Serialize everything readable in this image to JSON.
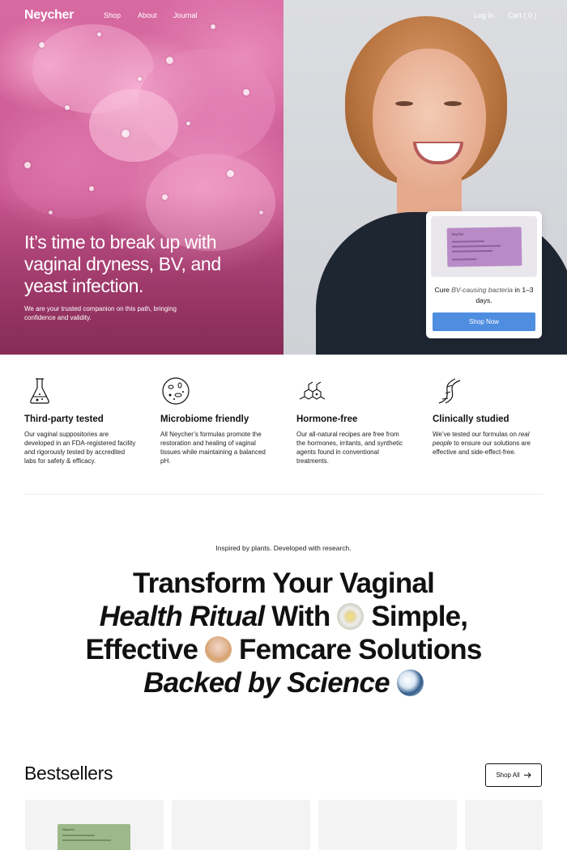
{
  "nav": {
    "logo": "Neycher",
    "links": [
      "Shop",
      "About",
      "Journal"
    ],
    "login": "Log In",
    "cart": "Cart ( 0 )"
  },
  "hero": {
    "headline": "It’s time to break up with vaginal dryness, BV, and yeast infection.",
    "subtext": "We are your trusted companion on this path, bringing confidence and validity.",
    "promo": {
      "pack_brand": "Neycher",
      "text_before": "Cure ",
      "text_em": "BV-causing bacteria",
      "text_after": " in 1–3 days.",
      "button": "Shop Now"
    }
  },
  "features": [
    {
      "icon": "flask-icon",
      "title": "Third-party tested",
      "body": "Our vaginal suppositories are developed in an FDA-registered facility and rigorously tested by accredited labs for safety & efficacy."
    },
    {
      "icon": "microbiome-icon",
      "title": "Microbiome friendly",
      "body": "All Neycher’s formulas promote the restoration and healing of vaginal tissues while maintaining a balanced pH."
    },
    {
      "icon": "molecule-icon",
      "title": "Hormone-free",
      "body": "Our all-natural recipes are free from the hormones, irritants, and synthetic agents found in conventional treatments."
    },
    {
      "icon": "dna-icon",
      "title": "Clinically studied",
      "body_before": "We’ve tested our formulas on ",
      "body_em": "real people",
      "body_after": " to ensure our solutions are effective and side-effect-free."
    }
  ],
  "transform": {
    "eyebrow": "Inspired by plants. Developed with research.",
    "line1": "Transform Your Vaginal",
    "line2_em": "Health Ritual",
    "line2_rest": " With ",
    "line2_end": " Simple,",
    "line3_a": "Effective ",
    "line3_b": " Femcare Solutions",
    "line4_em": "Backed by Science"
  },
  "bestsellers": {
    "title": "Bestsellers",
    "shop_all": "Shop All",
    "card_pack_brand": "Neycher"
  },
  "colors": {
    "accent": "#4e8de0",
    "hero_pink": "#d86aa2",
    "promo_pack": "#b88bc6",
    "green_pack": "#9db88b"
  }
}
